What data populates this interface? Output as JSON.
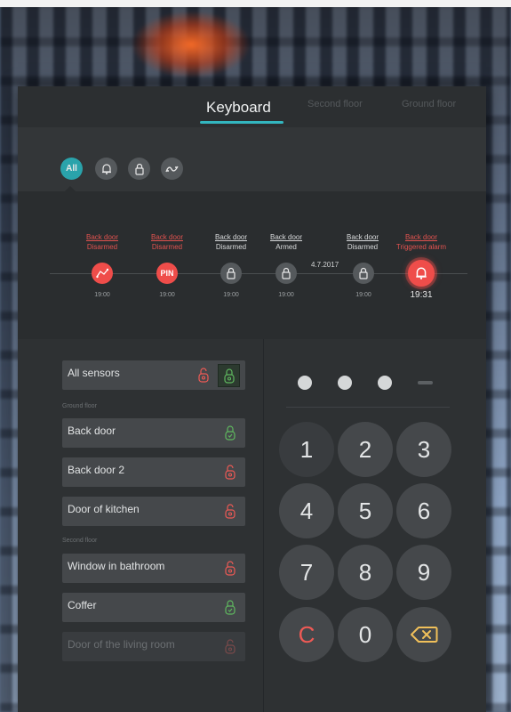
{
  "tabs": [
    {
      "label": "Keyboard",
      "active": true
    },
    {
      "label": "Second floor",
      "active": false
    },
    {
      "label": "Ground floor",
      "active": false
    }
  ],
  "filters": [
    {
      "label": "All",
      "icon": "all-icon",
      "active": true
    },
    {
      "label": "",
      "icon": "alarm-bell-icon",
      "active": false
    },
    {
      "label": "",
      "icon": "lock-icon",
      "active": false
    },
    {
      "label": "",
      "icon": "motion-wave-icon",
      "active": false
    }
  ],
  "timeline": {
    "date": "4.7.2017",
    "events": [
      {
        "name": "Back door",
        "status": "Disarmed",
        "time": "19:00",
        "icon": "motion-sensor-icon",
        "color": "#ef4d4a"
      },
      {
        "name": "Back door",
        "status": "Disarmed",
        "time": "19:00",
        "icon": "PIN",
        "color": "#ef4d4a"
      },
      {
        "name": "Back door",
        "status": "Disarmed",
        "time": "19:00",
        "icon": "lock-icon",
        "color": "#55595c"
      },
      {
        "name": "Back door",
        "status": "Armed",
        "time": "19:00",
        "icon": "lock-icon",
        "color": "#55595c"
      },
      {
        "name": "Back door",
        "status": "Disarmed",
        "time": "19:00",
        "icon": "lock-icon",
        "color": "#55595c"
      },
      {
        "name": "Back door",
        "status": "Triggered alarm",
        "time": "19:31",
        "icon": "alarm-bell-icon",
        "color": "#ef4d4a"
      }
    ]
  },
  "sensors": {
    "all_label": "All sensors",
    "sections": [
      {
        "title": "Ground floor",
        "items": [
          {
            "label": "Back door",
            "state": "armed"
          },
          {
            "label": "Back door 2",
            "state": "disarmed"
          },
          {
            "label": "Door of kitchen",
            "state": "disarmed"
          }
        ]
      },
      {
        "title": "Second floor",
        "items": [
          {
            "label": "Window in bathroom",
            "state": "disarmed"
          },
          {
            "label": "Coffer",
            "state": "armed"
          },
          {
            "label": "Door of the living room",
            "state": "disabled"
          }
        ]
      }
    ]
  },
  "keypad": {
    "pin_entered": 3,
    "pin_length": 4,
    "keys": [
      "1",
      "2",
      "3",
      "4",
      "5",
      "6",
      "7",
      "8",
      "9",
      "C",
      "0",
      "backspace-icon"
    ]
  },
  "colors": {
    "accent": "#33b6bf",
    "alert": "#ef4d4a",
    "armed": "#5fb85f",
    "disarmed": "#ef5a55"
  }
}
